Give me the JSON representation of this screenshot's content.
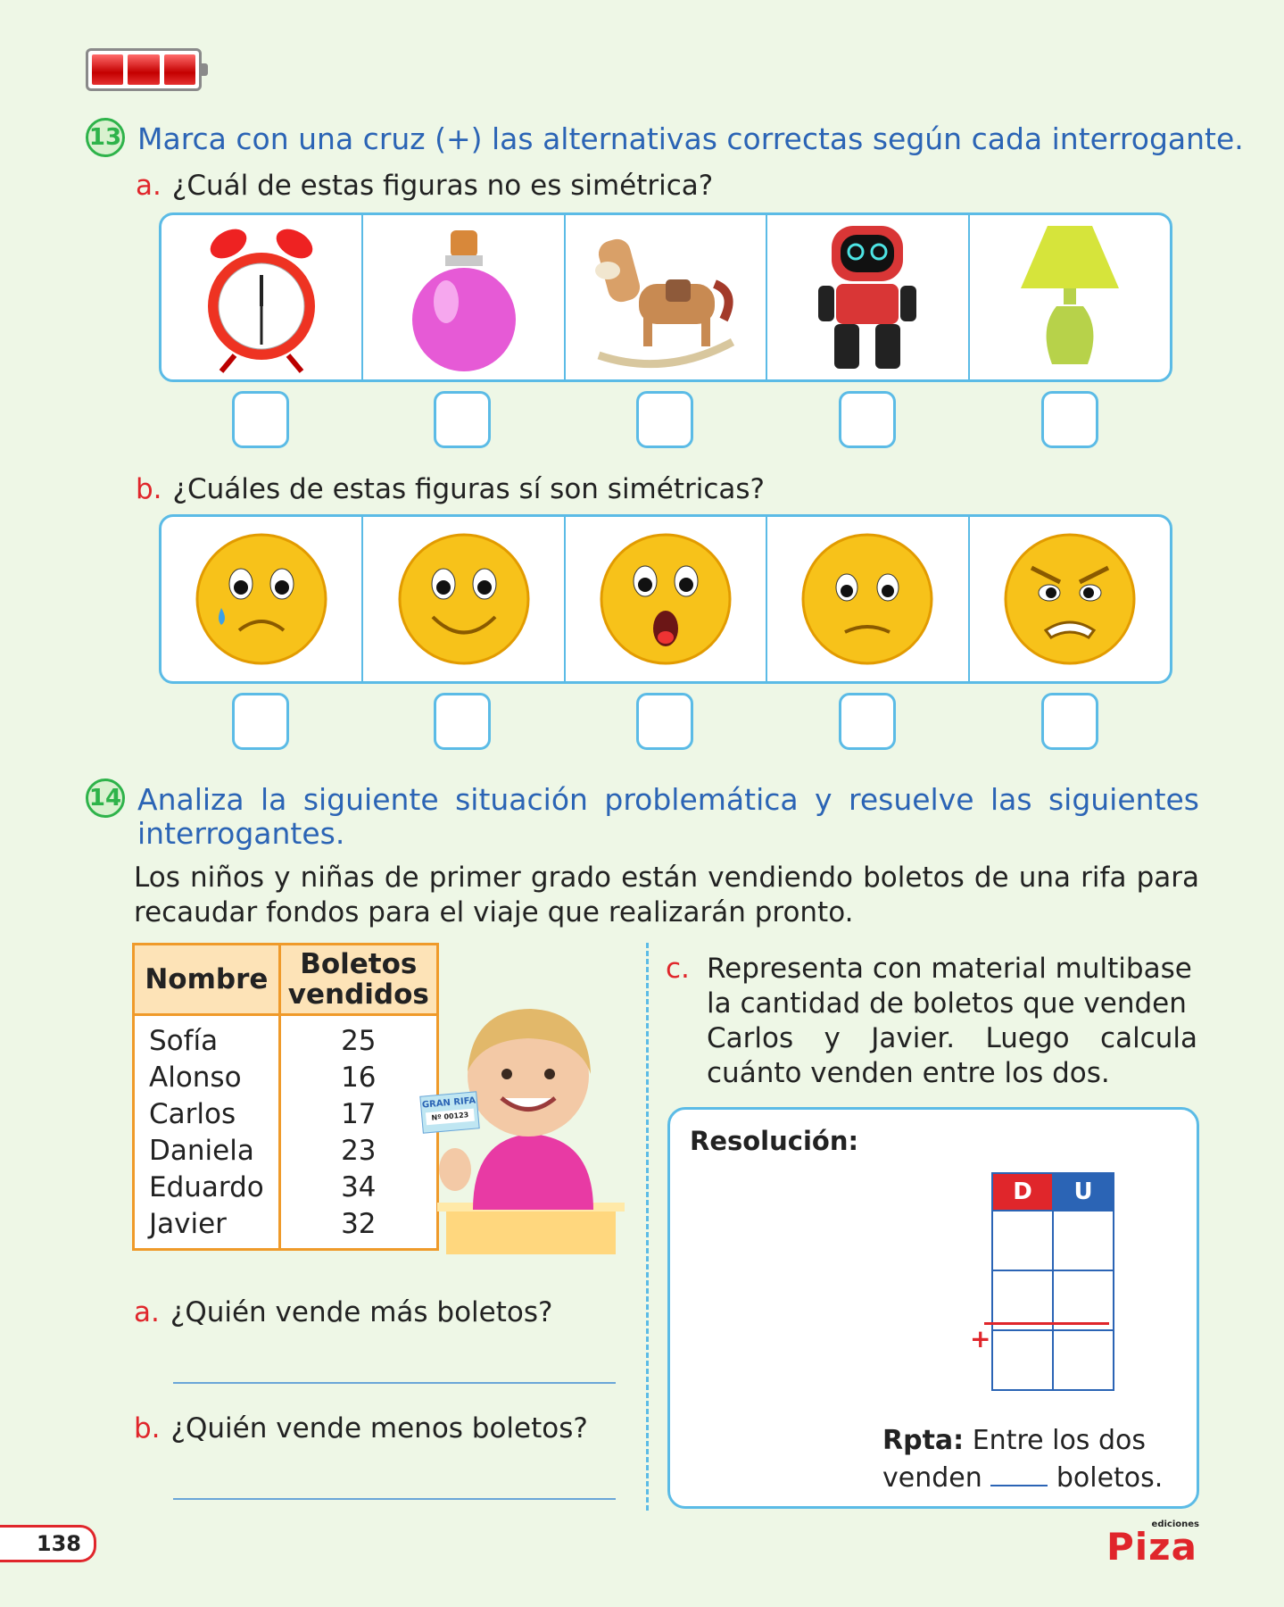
{
  "page_number": "138",
  "brand": {
    "name": "Piza",
    "tag": "ediciones"
  },
  "q13": {
    "number": "13",
    "text": "Marca con una cruz (+) las alternativas correctas según cada interrogante.",
    "a": {
      "letter": "a.",
      "text": "¿Cuál de estas figuras no es simétrica?"
    },
    "b": {
      "letter": "b.",
      "text": "¿Cuáles de estas figuras sí son simétricas?"
    }
  },
  "q14": {
    "number": "14",
    "text_line1": "Analiza la siguiente situación problemática y resuelve las siguientes",
    "text_line2": "interrogantes.",
    "intro_line1": "Los niños y niñas de primer grado están vendiendo boletos de una rifa para",
    "intro_line2": "recaudar fondos para el viaje que realizarán pronto.",
    "table": {
      "headers": [
        "Nombre",
        "Boletos vendidos"
      ],
      "rows": [
        [
          "Sofía",
          "25"
        ],
        [
          "Alonso",
          "16"
        ],
        [
          "Carlos",
          "17"
        ],
        [
          "Daniela",
          "23"
        ],
        [
          "Eduardo",
          "34"
        ],
        [
          "Javier",
          "32"
        ]
      ]
    },
    "ticket": {
      "line1": "GRAN RIFA",
      "line2": "Nº 00123"
    },
    "a": {
      "letter": "a.",
      "text": "¿Quién vende más boletos?"
    },
    "b": {
      "letter": "b.",
      "text": "¿Quién vende menos boletos?"
    },
    "c": {
      "letter": "c.",
      "line1": "Representa con material multibase",
      "line2": "la cantidad de boletos que venden",
      "line3": "Carlos y Javier. Luego calcula",
      "line4": "cuánto venden entre los dos."
    },
    "resolution": {
      "title": "Resolución:",
      "col_d": "D",
      "col_u": "U",
      "plus": "+",
      "rpta_label": "Rpta:",
      "rpta_line1": "Entre los dos",
      "rpta_pre": "venden",
      "rpta_post": "boletos."
    }
  },
  "colors": {
    "blue": "#2b64b5",
    "red": "#e0262b",
    "green": "#2eb34a",
    "orange": "#ef9a2a",
    "frame": "#5bbbe6"
  }
}
